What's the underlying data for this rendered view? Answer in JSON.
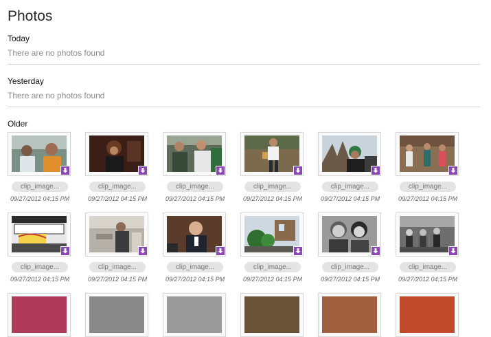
{
  "page": {
    "title": "Photos"
  },
  "sections": {
    "today": {
      "heading": "Today",
      "empty_message": "There are no photos found"
    },
    "yesterday": {
      "heading": "Yesterday",
      "empty_message": "There are no photos found"
    },
    "older": {
      "heading": "Older"
    }
  },
  "colors": {
    "download_badge": "#8b47b4",
    "divider": "#d5d5d5",
    "pill": "#e4e4e4"
  },
  "icons": {
    "download": "download-arrow-icon"
  },
  "photos": [
    {
      "name": "clip_image...",
      "date": "09/27/2012 04:15 PM"
    },
    {
      "name": "clip_image...",
      "date": "09/27/2012 04:15 PM"
    },
    {
      "name": "clip_image...",
      "date": "09/27/2012 04:15 PM"
    },
    {
      "name": "clip_image...",
      "date": "09/27/2012 04:15 PM"
    },
    {
      "name": "clip_image...",
      "date": "09/27/2012 04:15 PM"
    },
    {
      "name": "clip_image...",
      "date": "09/27/2012 04:15 PM"
    },
    {
      "name": "clip_image...",
      "date": "09/27/2012 04:15 PM"
    },
    {
      "name": "clip_image...",
      "date": "09/27/2012 04:15 PM"
    },
    {
      "name": "clip_image...",
      "date": "09/27/2012 04:15 PM"
    },
    {
      "name": "clip_image...",
      "date": "09/27/2012 04:15 PM"
    },
    {
      "name": "clip_image...",
      "date": "09/27/2012 04:15 PM"
    },
    {
      "name": "clip_image...",
      "date": "09/27/2012 04:15 PM"
    }
  ]
}
